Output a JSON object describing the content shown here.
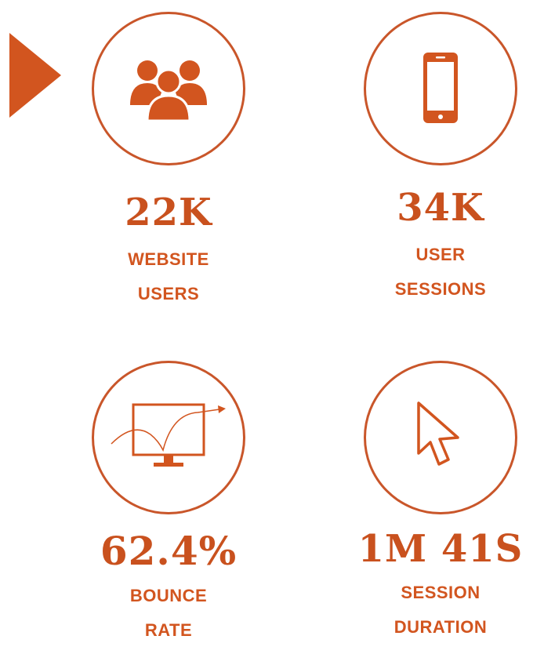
{
  "colors": {
    "accent": "#c9511e",
    "ring": "#c9562a"
  },
  "stats": [
    {
      "icon": "users-group-icon",
      "value": "22K",
      "label_line1": "WEBSITE",
      "label_line2": "USERS"
    },
    {
      "icon": "smartphone-icon",
      "value": "34K",
      "label_line1": "USER",
      "label_line2": "SESSIONS"
    },
    {
      "icon": "monitor-chart-icon",
      "value": "62.4%",
      "label_line1": "BOUNCE",
      "label_line2": "RATE"
    },
    {
      "icon": "cursor-arrow-icon",
      "value": "1M 41S",
      "label_line1": "SESSION",
      "label_line2": "DURATION"
    }
  ]
}
